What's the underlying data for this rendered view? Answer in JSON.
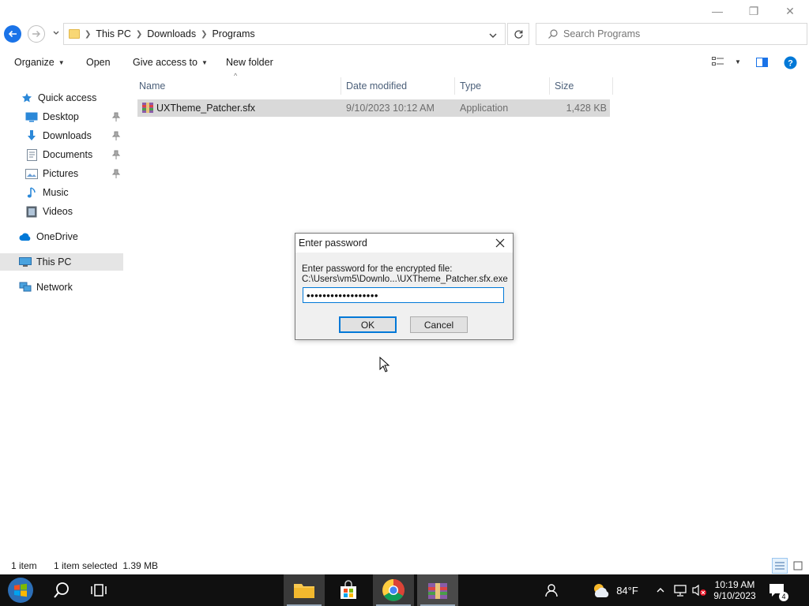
{
  "window": {
    "minimize": "—",
    "maximize": "❐",
    "close": "✕"
  },
  "address": {
    "crumbs": [
      "This PC",
      "Downloads",
      "Programs"
    ],
    "search_placeholder": "Search Programs"
  },
  "toolbar": {
    "organize": "Organize",
    "open": "Open",
    "give_access": "Give access to",
    "new_folder": "New folder"
  },
  "nav": {
    "quick_access": "Quick access",
    "items": [
      {
        "label": "Desktop",
        "icon": "desktop-icon",
        "pinned": true
      },
      {
        "label": "Downloads",
        "icon": "downloads-icon",
        "pinned": true
      },
      {
        "label": "Documents",
        "icon": "documents-icon",
        "pinned": true
      },
      {
        "label": "Pictures",
        "icon": "pictures-icon",
        "pinned": true
      },
      {
        "label": "Music",
        "icon": "music-icon",
        "pinned": false
      },
      {
        "label": "Videos",
        "icon": "videos-icon",
        "pinned": false
      }
    ],
    "onedrive": "OneDrive",
    "this_pc": "This PC",
    "network": "Network"
  },
  "columns": {
    "name": "Name",
    "date_modified": "Date modified",
    "type": "Type",
    "size": "Size"
  },
  "files": [
    {
      "name": "UXTheme_Patcher.sfx",
      "date": "9/10/2023 10:12 AM",
      "type": "Application",
      "size": "1,428 KB",
      "selected": true
    }
  ],
  "dialog": {
    "title": "Enter password",
    "prompt_line1": "Enter password for the encrypted file:",
    "prompt_line2": "C:\\Users\\vm5\\Downlo...\\UXTheme_Patcher.sfx.exe",
    "password_value": "••••••••••••••••••",
    "ok": "OK",
    "cancel": "Cancel"
  },
  "status": {
    "item_count": "1 item",
    "selection": "1 item selected  1.39 MB"
  },
  "taskbar": {
    "weather": "84°F",
    "time": "10:19 AM",
    "date": "9/10/2023",
    "notification_count": "4"
  },
  "colors": {
    "accent": "#0078d7",
    "selected_row": "#d9d9d9",
    "taskbar": "#101010"
  }
}
